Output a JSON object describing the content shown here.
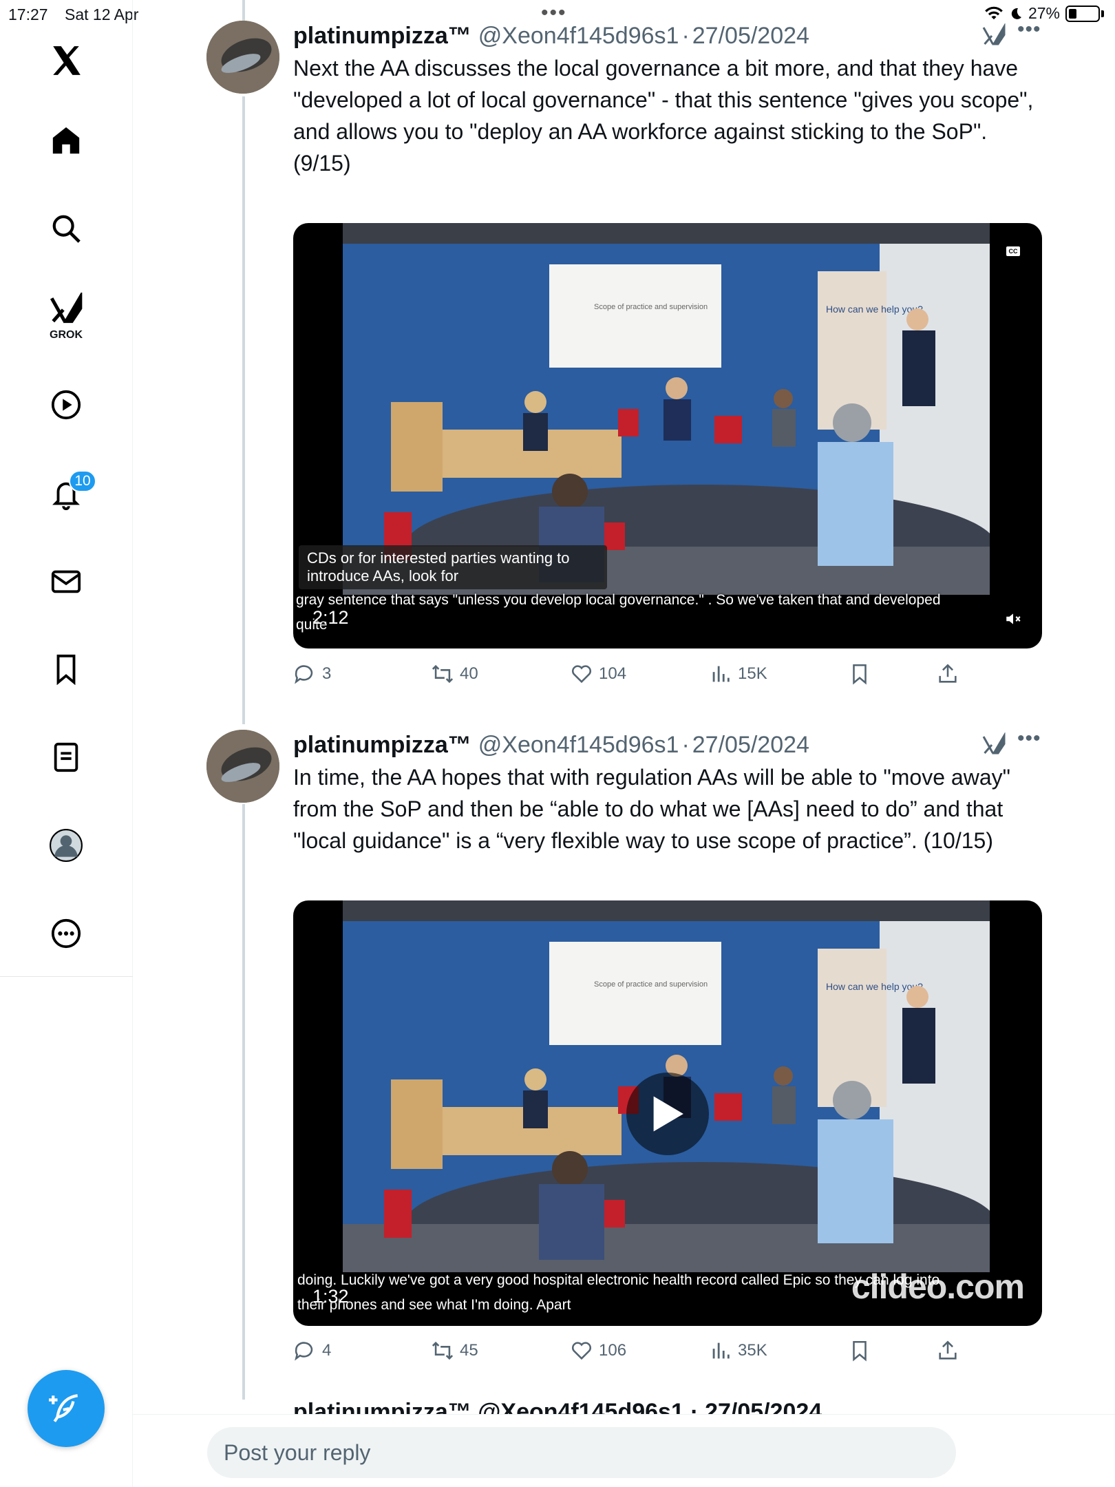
{
  "status_bar": {
    "time": "17:27",
    "date": "Sat 12 Apr",
    "battery": "27%",
    "battery_level": 0.27
  },
  "sidebar": {
    "items": [
      {
        "name": "x-logo"
      },
      {
        "name": "home"
      },
      {
        "name": "search"
      },
      {
        "name": "grok",
        "label": "GROK"
      },
      {
        "name": "video"
      },
      {
        "name": "notifications",
        "badge": "10"
      },
      {
        "name": "messages"
      },
      {
        "name": "bookmarks"
      },
      {
        "name": "lists"
      },
      {
        "name": "profile"
      },
      {
        "name": "more"
      }
    ],
    "accent": "#1d9bf0"
  },
  "tweets": [
    {
      "display_name": "platinumpizza™",
      "handle": "@Xeon4f145d96s1",
      "date": "27/05/2024",
      "text": "Next the AA discusses the local governance a bit more, and that they have \"developed a lot of local governance\" - that this sentence \"gives you scope\", and allows you to \"deploy an AA workforce against sticking to the SoP\".\n(9/15)",
      "video": {
        "slide_title": "Scope of practice and supervision",
        "banner_text": "How can we help you?",
        "caption_box": "CDs or for interested parties wanting to introduce AAs, look for",
        "caption_line1": "gray sentence that says \"unless you develop local governance.\"  .  So we've taken that and developed",
        "caption_line2": "quite",
        "duration": "2:12"
      },
      "actions": {
        "replies": "3",
        "reposts": "40",
        "likes": "104",
        "views": "15K"
      }
    },
    {
      "display_name": "platinumpizza™",
      "handle": "@Xeon4f145d96s1",
      "date": "27/05/2024",
      "text": "In time, the AA hopes that with regulation AAs will be able to \"move away\" from the SoP and then be “able to do what we [AAs] need to do” and that \"local guidance\" is a “very flexible way to use scope of practice”. (10/15)",
      "video": {
        "slide_title": "Scope of practice and supervision",
        "banner_text": "How can we help you?",
        "caption_line1": "doing.  Luckily we've got a very good hospital electronic health record called Epic so they can log into",
        "caption_line2": "their phones and see what I'm doing.  Apart",
        "duration": "1:32",
        "watermark": "clideo.com"
      },
      "actions": {
        "replies": "4",
        "reposts": "45",
        "likes": "106",
        "views": "35K"
      }
    }
  ],
  "next_tweet_peek": "platinumpizza™ @Xeon4f145d96s1 · 27/05/2024",
  "reply": {
    "placeholder": "Post your reply"
  }
}
